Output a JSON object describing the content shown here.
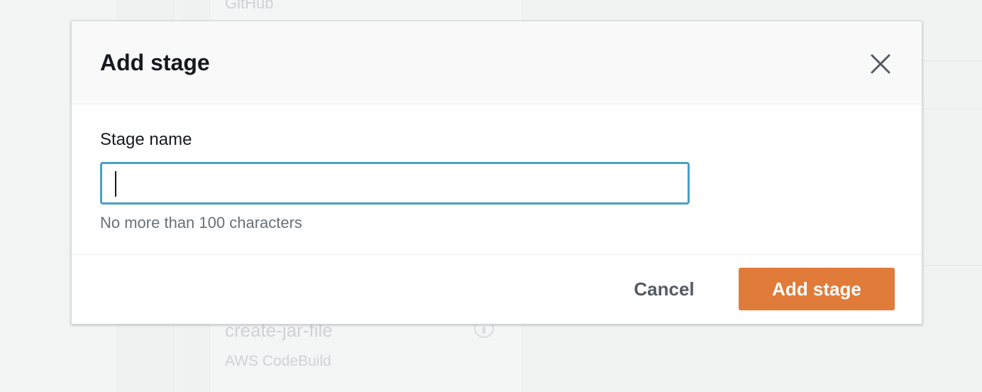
{
  "background": {
    "card_top_label": "GitHub",
    "card_action_name": "create-jar-file",
    "card_provider": "AWS CodeBuild"
  },
  "modal": {
    "title": "Add stage",
    "field": {
      "label": "Stage name",
      "value": "",
      "hint": "No more than 100 characters"
    },
    "cancel_label": "Cancel",
    "primary_label": "Add stage",
    "close_icon": "close-icon"
  },
  "colors": {
    "primary": "#e07b39",
    "focus_border": "#4aa0c6",
    "title": "#16191f",
    "muted": "#687078"
  }
}
